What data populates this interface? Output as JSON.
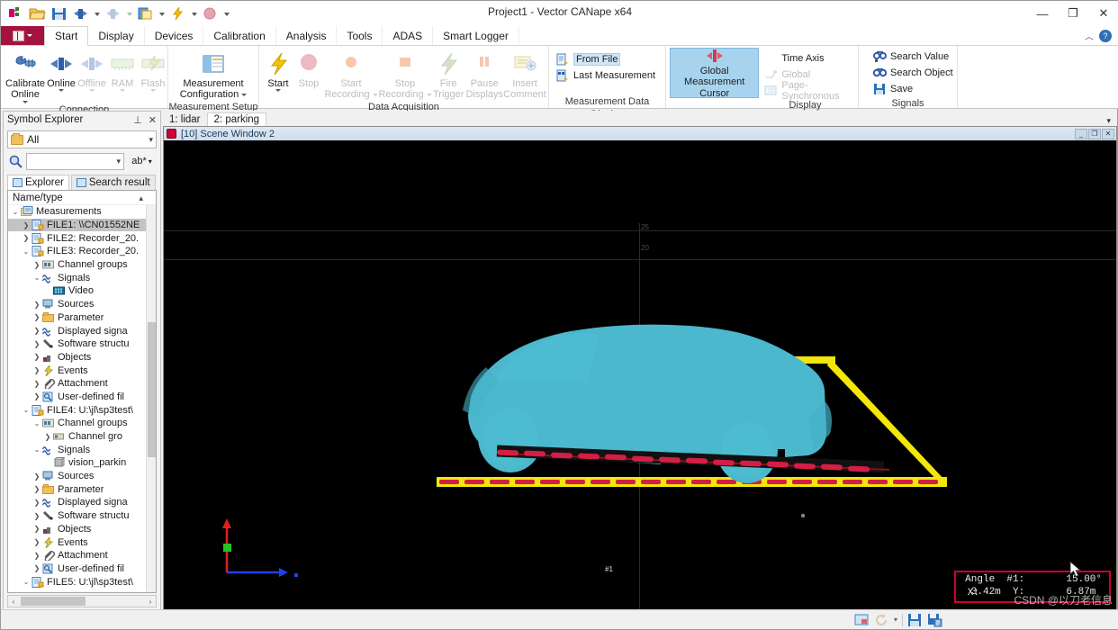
{
  "window": {
    "title": "Project1 - Vector CANape x64",
    "minimize": "—",
    "restore": "❐",
    "close": "✕"
  },
  "quick_access": {
    "icons": [
      "canape-logo-icon",
      "open-folder-icon",
      "save-icon",
      "online-icon",
      "offline-icon",
      "copy-icon",
      "flash-icon",
      "record-icon",
      "customize-qat-icon"
    ]
  },
  "ribbon_tabs": [
    {
      "label": "Start",
      "active": true
    },
    {
      "label": "Display",
      "active": false
    },
    {
      "label": "Devices",
      "active": false
    },
    {
      "label": "Calibration",
      "active": false
    },
    {
      "label": "Analysis",
      "active": false
    },
    {
      "label": "Tools",
      "active": false
    },
    {
      "label": "ADAS",
      "active": false
    },
    {
      "label": "Smart Logger",
      "active": false
    }
  ],
  "ribbon": {
    "groups": [
      {
        "title": "Connection",
        "big_buttons": [
          {
            "label_line1": "Calibrate",
            "label_line2": "Online",
            "dropdown": true,
            "disabled": false,
            "icon": "calibrate-online-icon"
          },
          {
            "label_line1": "Online",
            "label_line2": "",
            "dropdown": true,
            "disabled": false,
            "icon": "online-icon"
          },
          {
            "label_line1": "Offline",
            "label_line2": "",
            "dropdown": true,
            "disabled": true,
            "icon": "offline-icon"
          },
          {
            "label_line1": "RAM",
            "label_line2": "",
            "dropdown": true,
            "disabled": true,
            "icon": "ram-icon"
          },
          {
            "label_line1": "Flash",
            "label_line2": "",
            "dropdown": true,
            "disabled": true,
            "icon": "flash-icon"
          }
        ]
      },
      {
        "title": "Measurement Setup",
        "big_buttons": [
          {
            "label_line1": "Measurement",
            "label_line2": "Configuration",
            "dropdown": true,
            "disabled": false,
            "icon": "measurement-configuration-icon"
          }
        ]
      },
      {
        "title": "Data Acquisition",
        "big_buttons": [
          {
            "label_line1": "Start",
            "label_line2": "",
            "dropdown": true,
            "disabled": false,
            "icon": "start-icon"
          },
          {
            "label_line1": "Stop",
            "label_line2": "",
            "dropdown": false,
            "disabled": true,
            "icon": "stop-icon"
          },
          {
            "label_line1": "Start",
            "label_line2": "Recording",
            "dropdown": true,
            "disabled": true,
            "icon": "start-recording-icon"
          },
          {
            "label_line1": "Stop",
            "label_line2": "Recording",
            "dropdown": true,
            "disabled": true,
            "icon": "stop-recording-icon"
          },
          {
            "label_line1": "Fire",
            "label_line2": "Trigger",
            "dropdown": false,
            "disabled": true,
            "icon": "fire-trigger-icon"
          },
          {
            "label_line1": "Pause",
            "label_line2": "Displays",
            "dropdown": false,
            "disabled": true,
            "icon": "pause-displays-icon"
          },
          {
            "label_line1": "Insert",
            "label_line2": "Comment",
            "dropdown": false,
            "disabled": true,
            "icon": "insert-comment-icon"
          }
        ]
      },
      {
        "title": "Measurement Data Display",
        "small_buttons": [
          {
            "label": "From File",
            "disabled": false,
            "highlighted": true,
            "icon": "from-file-icon"
          },
          {
            "label": "Last Measurement",
            "disabled": false,
            "highlighted": false,
            "icon": "last-measurement-icon"
          }
        ]
      },
      {
        "title": "Display",
        "toggle": {
          "label_line1": "Global Measurement",
          "label_line2": "Cursor",
          "active": true,
          "icon": "global-measurement-cursor-icon"
        },
        "small_buttons": [
          {
            "label": "Time Axis",
            "disabled": false,
            "highlighted": false,
            "icon": "time-axis-icon"
          },
          {
            "label": "Global",
            "disabled": true,
            "highlighted": false,
            "icon": "global-icon"
          },
          {
            "label": "Page-Synchronous",
            "disabled": true,
            "highlighted": false,
            "icon": "page-synchronous-icon"
          }
        ]
      },
      {
        "title": "Signals",
        "small_buttons": [
          {
            "label": "Search Value",
            "disabled": false,
            "highlighted": false,
            "icon": "search-value-icon"
          },
          {
            "label": "Search Object",
            "disabled": false,
            "highlighted": false,
            "icon": "search-object-icon"
          },
          {
            "label": "Save",
            "disabled": false,
            "highlighted": false,
            "icon": "save-icon"
          }
        ]
      }
    ]
  },
  "symbol_explorer": {
    "title": "Symbol Explorer",
    "pin_icon": "pin-icon",
    "close_icon": "close-icon",
    "filter_value": "All",
    "search_value": "",
    "match_mode": "ab*",
    "tabs": [
      {
        "label": "Explorer",
        "active": true
      },
      {
        "label": "Search result",
        "active": false
      }
    ],
    "tree_header": "Name/type",
    "tree": [
      {
        "depth": 0,
        "twisty": "v",
        "icon": "measurements-folder-icon",
        "label": "Measurements",
        "selected": false
      },
      {
        "depth": 1,
        "twisty": ">",
        "icon": "file-icon",
        "label": "FILE1: \\\\CN01552NE",
        "selected": true
      },
      {
        "depth": 1,
        "twisty": ">",
        "icon": "file-icon",
        "label": "FILE2: Recorder_20.",
        "selected": false
      },
      {
        "depth": 1,
        "twisty": "v",
        "icon": "file-icon",
        "label": "FILE3: Recorder_20.",
        "selected": false
      },
      {
        "depth": 2,
        "twisty": ">",
        "icon": "channel-groups-icon",
        "label": "Channel groups",
        "selected": false
      },
      {
        "depth": 2,
        "twisty": "v",
        "icon": "signals-icon",
        "label": "Signals",
        "selected": false
      },
      {
        "depth": 3,
        "twisty": "",
        "icon": "video-icon",
        "label": "Video",
        "selected": false
      },
      {
        "depth": 2,
        "twisty": ">",
        "icon": "sources-icon",
        "label": "Sources",
        "selected": false
      },
      {
        "depth": 2,
        "twisty": ">",
        "icon": "parameter-icon",
        "label": "Parameter",
        "selected": false
      },
      {
        "depth": 2,
        "twisty": ">",
        "icon": "displayed-signals-icon",
        "label": "Displayed signa",
        "selected": false
      },
      {
        "depth": 2,
        "twisty": ">",
        "icon": "software-structure-icon",
        "label": "Software structu",
        "selected": false
      },
      {
        "depth": 2,
        "twisty": ">",
        "icon": "objects-icon",
        "label": "Objects",
        "selected": false
      },
      {
        "depth": 2,
        "twisty": ">",
        "icon": "events-icon",
        "label": "Events",
        "selected": false
      },
      {
        "depth": 2,
        "twisty": ">",
        "icon": "attachment-icon",
        "label": "Attachment",
        "selected": false
      },
      {
        "depth": 2,
        "twisty": ">",
        "icon": "user-defined-files-icon",
        "label": "User-defined fil",
        "selected": false
      },
      {
        "depth": 1,
        "twisty": "v",
        "icon": "file-icon",
        "label": "FILE4: U:\\jl\\sp3test\\",
        "selected": false
      },
      {
        "depth": 2,
        "twisty": "v",
        "icon": "channel-groups-icon",
        "label": "Channel groups",
        "selected": false
      },
      {
        "depth": 3,
        "twisty": ">",
        "icon": "channel-group-icon",
        "label": "Channel gro",
        "selected": false
      },
      {
        "depth": 2,
        "twisty": "v",
        "icon": "signals-icon",
        "label": "Signals",
        "selected": false
      },
      {
        "depth": 3,
        "twisty": "",
        "icon": "signal-item-icon",
        "label": "vision_parkin",
        "selected": false
      },
      {
        "depth": 2,
        "twisty": ">",
        "icon": "sources-icon",
        "label": "Sources",
        "selected": false
      },
      {
        "depth": 2,
        "twisty": ">",
        "icon": "parameter-icon",
        "label": "Parameter",
        "selected": false
      },
      {
        "depth": 2,
        "twisty": ">",
        "icon": "displayed-signals-icon",
        "label": "Displayed signa",
        "selected": false
      },
      {
        "depth": 2,
        "twisty": ">",
        "icon": "software-structure-icon",
        "label": "Software structu",
        "selected": false
      },
      {
        "depth": 2,
        "twisty": ">",
        "icon": "objects-icon",
        "label": "Objects",
        "selected": false
      },
      {
        "depth": 2,
        "twisty": ">",
        "icon": "events-icon",
        "label": "Events",
        "selected": false
      },
      {
        "depth": 2,
        "twisty": ">",
        "icon": "attachment-icon",
        "label": "Attachment",
        "selected": false
      },
      {
        "depth": 2,
        "twisty": ">",
        "icon": "user-defined-files-icon",
        "label": "User-defined fil",
        "selected": false
      },
      {
        "depth": 1,
        "twisty": "v",
        "icon": "file-icon",
        "label": "FILE5: U:\\jl\\sp3test\\",
        "selected": false
      }
    ]
  },
  "main_tabs": [
    {
      "label": "1: lidar",
      "active": false
    },
    {
      "label": "2: parking",
      "active": true
    }
  ],
  "scene_window": {
    "title": "[10] Scene Window 2",
    "minimize": "_",
    "restore": "❐",
    "close": "✕",
    "grid_labels": [
      "25",
      "20"
    ],
    "axis_gizmo": {
      "y_color": "#e02020",
      "z_color": "#22c422",
      "x_color": "#2040ee"
    },
    "annotation_label": "#1",
    "car_color": "#4bb8cd",
    "boundary_color": "#f2e60a",
    "dash_color": "#d41e45",
    "readout": {
      "line1": "Angle  #1:       15.00°",
      "line2": " 3.42m  Y:       6.87m",
      "x_prefix": "X:",
      "border_color": "#cc0033"
    },
    "watermark": "CSDN @以刀老信息"
  },
  "status_bar": {
    "icons": [
      "display-icon",
      "refresh-icon",
      "dropdown-caret-icon",
      "save-icon",
      "save-as-icon"
    ]
  }
}
